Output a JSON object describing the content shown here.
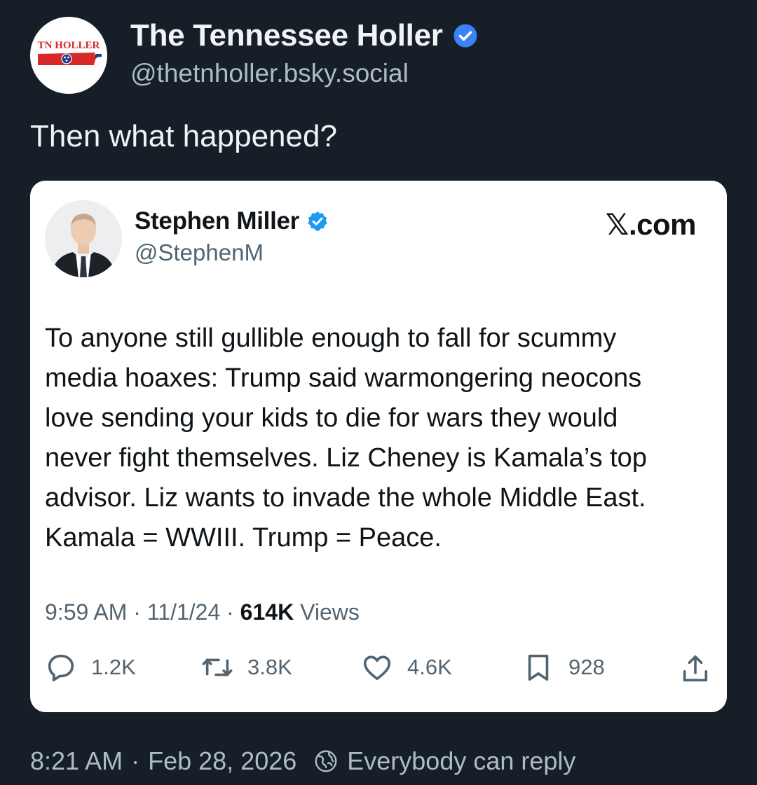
{
  "post": {
    "author": {
      "display_name": "The Tennessee Holler",
      "handle": "@thetnholler.bsky.social",
      "avatar_text": "TN HOLLER",
      "verified": true
    },
    "text": "Then what happened?",
    "timestamp": "8:21 AM",
    "date": "Feb 28, 2026",
    "separator": "·",
    "reply_setting": "Everybody can reply"
  },
  "embed": {
    "source": "𝕏.com",
    "author": {
      "display_name": "Stephen Miller",
      "handle": "@StephenM",
      "verified": true
    },
    "lines": [
      "To anyone still gullible enough to fall for scummy",
      "media hoaxes: Trump said warmongering neocons",
      "love sending your kids to die for wars they would",
      "never fight themselves. Liz Cheney is Kamala’s top",
      "advisor. Liz wants to invade the whole Middle East.",
      "Kamala = WWIII. Trump = Peace."
    ],
    "meta": {
      "time": "9:59 AM",
      "date": "11/1/24",
      "separator": "·",
      "views_count": "614K",
      "views_label": "Views"
    },
    "actions": {
      "replies": "1.2K",
      "reposts": "3.8K",
      "likes": "4.6K",
      "bookmarks": "928"
    }
  },
  "colors": {
    "background": "#161e27",
    "text_primary": "#f1f3f5",
    "text_secondary": "#aebbc9",
    "verified_blue": "#1d9bf0",
    "bluesky_verified": "#3b82f6",
    "tn_red": "#d62828",
    "tn_blue": "#1f3a93"
  },
  "icons": {
    "verified": "verified-check-icon",
    "reply": "speech-bubble-icon",
    "repost": "repost-arrows-icon",
    "like": "heart-icon",
    "bookmark": "bookmark-icon",
    "share": "share-upload-icon",
    "globe": "globe-icon"
  }
}
